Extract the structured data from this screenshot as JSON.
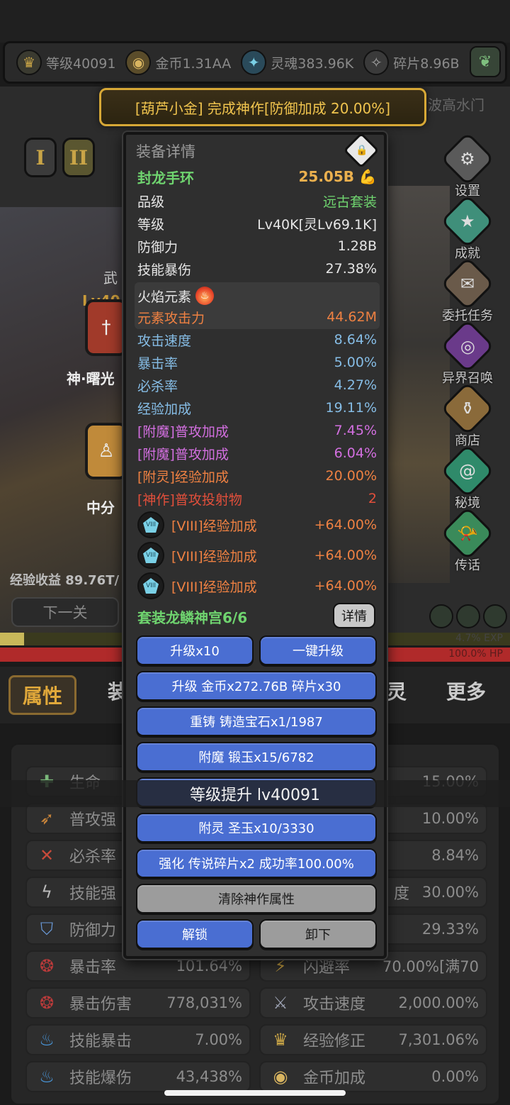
{
  "resources": {
    "level": "等级40091",
    "gold": "金币1.31AA",
    "soul": "灵魂383.96K",
    "shard": "碎片8.96B"
  },
  "scene": {
    "wave_text": "波高水门",
    "roman_1": "I",
    "roman_2": "II",
    "left_weapon_label": "武",
    "left_level": "Lv40",
    "card1_label": "神·曙光",
    "card2_label": "中分",
    "exp_income": "经验收益 89.76T/",
    "next_level_button": "下一关",
    "exp_bar": {
      "label": "4.7% EXP",
      "fraction": 0.047
    },
    "hp_bar": {
      "label": "100.0% HP",
      "fraction": 1.0
    }
  },
  "side_menu": [
    {
      "label": "设置",
      "icon": "gear-icon",
      "color": "#6a6a6a"
    },
    {
      "label": "成就",
      "icon": "star-icon",
      "color": "#3f8f7a"
    },
    {
      "label": "委托任务",
      "icon": "scroll-icon",
      "color": "#6a5a4a"
    },
    {
      "label": "异界召唤",
      "icon": "portal-icon",
      "color": "#6a3a8a"
    },
    {
      "label": "商店",
      "icon": "shop-icon",
      "color": "#8a6a3a"
    },
    {
      "label": "秘境",
      "icon": "vortex-icon",
      "color": "#2f8a6a"
    },
    {
      "label": "传话",
      "icon": "horn-icon",
      "color": "#3a8a5a"
    }
  ],
  "tabs": {
    "active": "属性",
    "t2": "装",
    "t3": "灵",
    "t4": "更多"
  },
  "stats": [
    {
      "name": "生命",
      "value": "15.00%",
      "icon": "plus-icon"
    },
    {
      "name": "普攻强",
      "value": "10.00%",
      "icon": "claw-icon"
    },
    {
      "name": "必杀率",
      "value": "8.84%",
      "icon": "slash-icon"
    },
    {
      "name": "技能强",
      "value": "30.00%",
      "right_name": "度",
      "icon": "bolt-icon"
    },
    {
      "name": "防御力",
      "value": "29.33%",
      "icon": "shield-icon"
    },
    {
      "name": "暴击率",
      "value": "101.64%",
      "right_name": "闪避率",
      "right_value": "70.00%[满70",
      "icon": "crit-icon"
    },
    {
      "name": "暴击伤害",
      "value": "778,031%",
      "right_name": "攻击速度",
      "right_value": "2,000.00%",
      "icon": "crit-damage-icon"
    },
    {
      "name": "技能暴击",
      "value": "7.00%",
      "right_name": "经验修正",
      "right_value": "7,301.06%",
      "icon": "flame-blue-icon"
    },
    {
      "name": "技能爆伤",
      "value": "43,438%",
      "right_name": "金币加成",
      "right_value": "0.00%",
      "icon": "flame-blue2-icon"
    }
  ],
  "banner": "[葫芦小金] 完成神作[防御加成 20.00%]",
  "equip": {
    "title": "装备详情",
    "name": "封龙手环",
    "power": "25.05B",
    "rows": [
      {
        "k": "品级",
        "v": "远古套装",
        "color": "green"
      },
      {
        "k": "等级",
        "v": "Lv40K[灵Lv69.1K]",
        "color": "white"
      },
      {
        "k": "防御力",
        "v": "1.28B",
        "color": "white"
      },
      {
        "k": "技能暴伤",
        "v": "27.38%",
        "color": "white"
      }
    ],
    "element": {
      "name": "火焰元素",
      "k": "元素攻击力",
      "v": "44.62M"
    },
    "attrs": [
      {
        "k": "攻击速度",
        "v": "8.64%",
        "color": "blue"
      },
      {
        "k": "暴击率",
        "v": "5.00%",
        "color": "blue"
      },
      {
        "k": "必杀率",
        "v": "4.27%",
        "color": "blue"
      },
      {
        "k": "经验加成",
        "v": "19.11%",
        "color": "blue"
      },
      {
        "k": "[附魔]普攻加成",
        "v": "7.45%",
        "color": "purple"
      },
      {
        "k": "[附魔]普攻加成",
        "v": "6.04%",
        "color": "purple"
      },
      {
        "k": "[附灵]经验加成",
        "v": "20.00%",
        "color": "orange"
      },
      {
        "k": "[神作]普攻投射物",
        "v": "2",
        "color": "red"
      }
    ],
    "gems": [
      {
        "k": "[VIII]经验加成",
        "v": "+64.00%"
      },
      {
        "k": "[VIII]经验加成",
        "v": "+64.00%"
      },
      {
        "k": "[VIII]经验加成",
        "v": "+64.00%"
      }
    ],
    "set_name": "套装龙鳞神宫6/6",
    "detail_button": "详情",
    "buttons": {
      "upgrade10": "升级x10",
      "oneclick": "一键升级",
      "upgrade": "升级 金币x272.76B 碎片x30",
      "reforge": "重铸 铸造宝石x1/1987",
      "enchant": "附魔 锻玉x15/6782",
      "spirit": "附灵 圣玉x10/3330",
      "strengthen": "强化 传说碎片x2 成功率100.00%",
      "clear": "清除神作属性",
      "unlock": "解锁",
      "unequip": "卸下"
    }
  },
  "toast": "等级提升 lv40091"
}
